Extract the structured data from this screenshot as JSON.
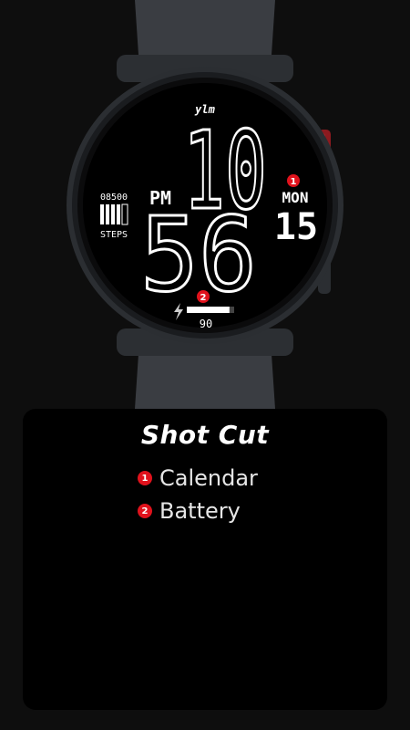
{
  "watch": {
    "brand": "ylm",
    "hours": "10",
    "minutes": "56",
    "ampm": "PM",
    "steps_value": "08500",
    "steps_label": "STEPS",
    "day": "MON",
    "date": "15",
    "battery_value": "90",
    "battery_level": 0.9,
    "badge1": "1",
    "badge2": "2"
  },
  "panel": {
    "title": "Shot Cut",
    "items": [
      {
        "badge": "1",
        "label": "Calendar"
      },
      {
        "badge": "2",
        "label": "Battery"
      }
    ]
  },
  "colors": {
    "accent": "#e0121c",
    "background": "#0e0e0e",
    "strap": "#3a3d42"
  }
}
